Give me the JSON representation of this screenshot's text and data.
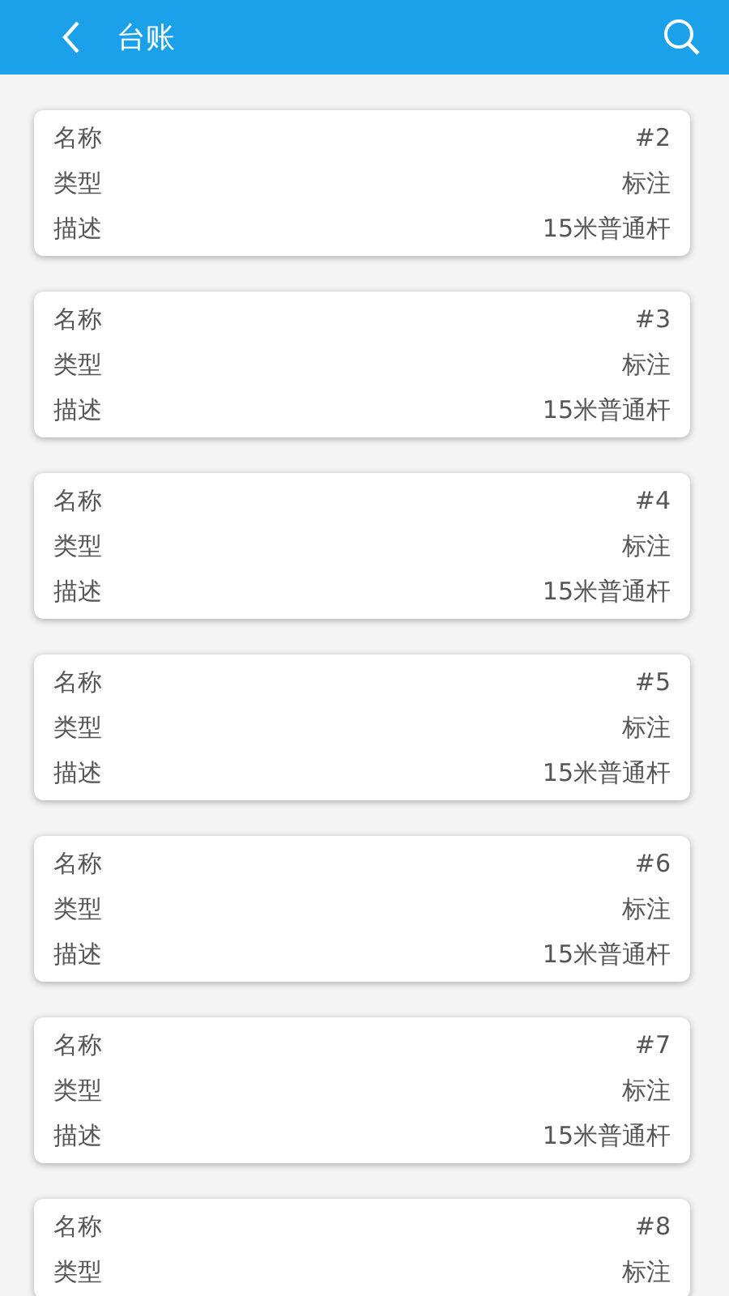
{
  "header": {
    "title": "台账"
  },
  "cards": [
    {
      "rows": [
        {
          "label": "名称",
          "value": "#2"
        },
        {
          "label": "类型",
          "value": "标注"
        },
        {
          "label": "描述",
          "value": "15米普通杆"
        }
      ]
    },
    {
      "rows": [
        {
          "label": "名称",
          "value": "#3"
        },
        {
          "label": "类型",
          "value": "标注"
        },
        {
          "label": "描述",
          "value": "15米普通杆"
        }
      ]
    },
    {
      "rows": [
        {
          "label": "名称",
          "value": "#4"
        },
        {
          "label": "类型",
          "value": "标注"
        },
        {
          "label": "描述",
          "value": "15米普通杆"
        }
      ]
    },
    {
      "rows": [
        {
          "label": "名称",
          "value": "#5"
        },
        {
          "label": "类型",
          "value": "标注"
        },
        {
          "label": "描述",
          "value": "15米普通杆"
        }
      ]
    },
    {
      "rows": [
        {
          "label": "名称",
          "value": "#6"
        },
        {
          "label": "类型",
          "value": "标注"
        },
        {
          "label": "描述",
          "value": "15米普通杆"
        }
      ]
    },
    {
      "rows": [
        {
          "label": "名称",
          "value": "#7"
        },
        {
          "label": "类型",
          "value": "标注"
        },
        {
          "label": "描述",
          "value": "15米普通杆"
        }
      ]
    },
    {
      "rows": [
        {
          "label": "名称",
          "value": "#8"
        },
        {
          "label": "类型",
          "value": "标注"
        }
      ]
    }
  ]
}
